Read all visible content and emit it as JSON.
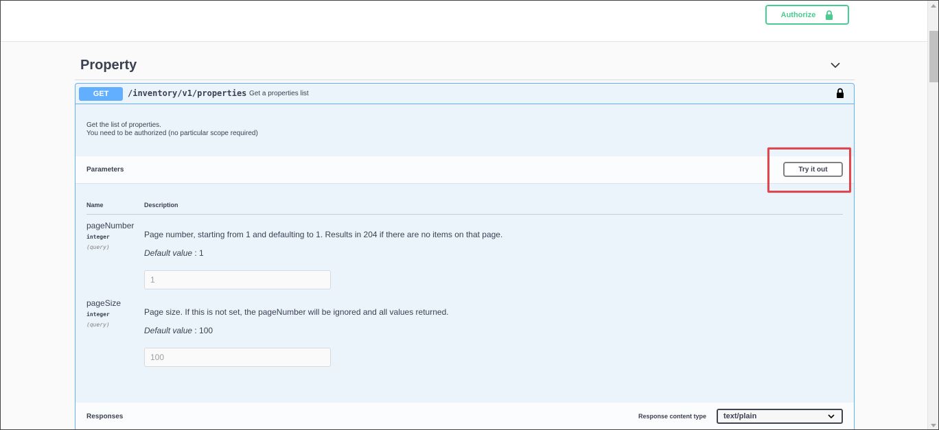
{
  "topbar": {
    "authorize_label": "Authorize"
  },
  "section": {
    "title": "Property"
  },
  "operation": {
    "method": "GET",
    "path": "/inventory/v1/properties",
    "summary": "Get a properties list",
    "description_line1": "Get the list of properties.",
    "description_line2": "You need to be authorized (no particular scope required)"
  },
  "parameters": {
    "title": "Parameters",
    "try_label": "Try it out",
    "col_name": "Name",
    "col_description": "Description",
    "items": [
      {
        "name": "pageNumber",
        "type": "integer",
        "in": "(query)",
        "description": "Page number, starting from 1 and defaulting to 1. Results in 204 if there are no items on that page.",
        "default_label": "Default value",
        "default_value": " : 1",
        "placeholder": "1"
      },
      {
        "name": "pageSize",
        "type": "integer",
        "in": "(query)",
        "description": "Page size. If this is not set, the pageNumber will be ignored and all values returned.",
        "default_label": "Default value",
        "default_value": " : 100",
        "placeholder": "100"
      }
    ]
  },
  "responses": {
    "title": "Responses",
    "content_type_label": "Response content type",
    "content_type_value": "text/plain"
  },
  "icons": {
    "authorize": "lock-icon",
    "section_toggle": "chevron-down-icon",
    "operation_lock": "lock-icon",
    "select_arrow": "chevron-down-icon"
  },
  "colors": {
    "get_method": "#61affe",
    "authorize_green": "#49cc90",
    "highlight_red": "#e0474c",
    "opblock_bg": "#ebf3fb"
  }
}
